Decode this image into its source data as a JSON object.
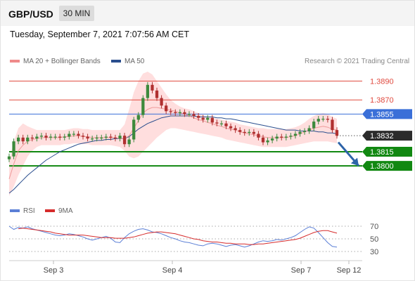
{
  "header": {
    "symbol": "GBP/USD",
    "timeframe": "30 MIN"
  },
  "datetime": "Tuesday, September 7, 2021 7:07:56 AM CET",
  "legend": {
    "bb_label": "MA 20 + Bollinger Bands",
    "ma50_label": "MA 50",
    "credit": "Research © 2021 Trading Central",
    "rsi_label": "RSI",
    "rsi_ma_label": "9MA"
  },
  "colors": {
    "resistance": "#e04a3f",
    "pivot": "#3a6fd8",
    "support": "#118811",
    "current": "#2b2b2b",
    "bands": "#ffd3d3",
    "ma20": "#ef9a9a",
    "ma50": "#2a4e8e",
    "candle_up": "#3c8a3c",
    "candle_down": "#b03030",
    "arrow": "#2d63a8",
    "rsi": "#5b7fd6",
    "rsi_ma": "#d62b2b"
  },
  "chart_data": {
    "type": "line",
    "subtype": "candlestick",
    "price_range": [
      1.3765,
      1.3903
    ],
    "x_ticks": [
      "Sep 3",
      "Sep 4",
      "Sep 7",
      "Sep 12"
    ],
    "levels": [
      {
        "value": 1.389,
        "label": "1.3890",
        "role": "resistance"
      },
      {
        "value": 1.387,
        "label": "1.3870",
        "role": "resistance"
      },
      {
        "value": 1.3855,
        "label": "1.3855",
        "role": "pivot"
      },
      {
        "value": 1.3832,
        "label": "1.3832",
        "role": "current"
      },
      {
        "value": 1.3815,
        "label": "1.3815",
        "role": "support"
      },
      {
        "value": 1.38,
        "label": "1.3800",
        "role": "support"
      }
    ],
    "close_series": [
      1.381,
      1.3826,
      1.383,
      1.3826,
      1.383,
      1.3829,
      1.3831,
      1.3832,
      1.383,
      1.3831,
      1.3831,
      1.383,
      1.3831,
      1.3834,
      1.3834,
      1.3832,
      1.3831,
      1.3829,
      1.3829,
      1.383,
      1.383,
      1.3831,
      1.383,
      1.3829,
      1.3832,
      1.3823,
      1.3828,
      1.3849,
      1.3854,
      1.3872,
      1.3886,
      1.388,
      1.3872,
      1.3864,
      1.3858,
      1.3857,
      1.3856,
      1.3857,
      1.3855,
      1.3855,
      1.3853,
      1.3851,
      1.3849,
      1.3851,
      1.3846,
      1.3845,
      1.3845,
      1.3842,
      1.384,
      1.3838,
      1.3836,
      1.3835,
      1.3836,
      1.3834,
      1.383,
      1.3825,
      1.3827,
      1.3829,
      1.3831,
      1.383,
      1.3831,
      1.3832,
      1.3834,
      1.3836,
      1.3837,
      1.384,
      1.3847,
      1.385,
      1.385,
      1.3849,
      1.3838,
      1.3832
    ],
    "ma20": [
      1.3786,
      1.3802,
      1.3816,
      1.3822,
      1.3826,
      1.3828,
      1.3829,
      1.383,
      1.383,
      1.383,
      1.383,
      1.383,
      1.3831,
      1.3831,
      1.3832,
      1.3832,
      1.3831,
      1.3831,
      1.383,
      1.383,
      1.383,
      1.383,
      1.383,
      1.383,
      1.3829,
      1.3829,
      1.3832,
      1.384,
      1.3848,
      1.3856,
      1.386,
      1.3862,
      1.3862,
      1.3861,
      1.386,
      1.3859,
      1.3858,
      1.3856,
      1.3855,
      1.3853,
      1.3851,
      1.3849,
      1.3848,
      1.3846,
      1.3845,
      1.3843,
      1.3842,
      1.384,
      1.3839,
      1.3838,
      1.3836,
      1.3835,
      1.3834,
      1.3833,
      1.3832,
      1.3831,
      1.383,
      1.383,
      1.383,
      1.383,
      1.383,
      1.3831,
      1.3832,
      1.3834,
      1.3836,
      1.3838,
      1.384,
      1.3841,
      1.3842,
      1.3841,
      1.3839,
      1.3838
    ],
    "bb_upper": [
      1.3805,
      1.3826,
      1.384,
      1.3845,
      1.3842,
      1.384,
      1.3838,
      1.3838,
      1.3838,
      1.3838,
      1.3838,
      1.3838,
      1.3838,
      1.3839,
      1.384,
      1.384,
      1.3839,
      1.3839,
      1.3838,
      1.3838,
      1.3838,
      1.3838,
      1.3838,
      1.3838,
      1.3838,
      1.3844,
      1.386,
      1.3878,
      1.389,
      1.3898,
      1.39,
      1.3897,
      1.389,
      1.3883,
      1.3876,
      1.387,
      1.3866,
      1.3863,
      1.3861,
      1.386,
      1.3858,
      1.3856,
      1.3854,
      1.3852,
      1.3851,
      1.385,
      1.3849,
      1.3848,
      1.3847,
      1.3846,
      1.3844,
      1.3843,
      1.3842,
      1.3841,
      1.384,
      1.384,
      1.3839,
      1.3839,
      1.3839,
      1.3839,
      1.3839,
      1.384,
      1.3841,
      1.3843,
      1.3846,
      1.385,
      1.3853,
      1.3855,
      1.3856,
      1.3855,
      1.3852,
      1.385
    ],
    "bb_lower": [
      1.3768,
      1.3778,
      1.379,
      1.38,
      1.381,
      1.3816,
      1.382,
      1.3822,
      1.3822,
      1.3822,
      1.3822,
      1.3822,
      1.3823,
      1.3823,
      1.3824,
      1.3824,
      1.3823,
      1.3823,
      1.3822,
      1.3822,
      1.3822,
      1.3822,
      1.3822,
      1.3821,
      1.382,
      1.3816,
      1.381,
      1.3808,
      1.381,
      1.3815,
      1.382,
      1.3825,
      1.383,
      1.3834,
      1.3838,
      1.384,
      1.384,
      1.3839,
      1.3838,
      1.3837,
      1.3836,
      1.3835,
      1.3834,
      1.3833,
      1.3832,
      1.3831,
      1.383,
      1.3828,
      1.3827,
      1.3826,
      1.3825,
      1.3824,
      1.3823,
      1.3822,
      1.3821,
      1.382,
      1.382,
      1.382,
      1.382,
      1.382,
      1.382,
      1.3821,
      1.3822,
      1.3823,
      1.3824,
      1.3825,
      1.3826,
      1.3826,
      1.3826,
      1.3826,
      1.3825,
      1.3824
    ],
    "ma50": [
      1.3771,
      1.3775,
      1.378,
      1.3785,
      1.379,
      1.3794,
      1.3798,
      1.3802,
      1.3806,
      1.3809,
      1.3812,
      1.3815,
      1.3817,
      1.3819,
      1.3821,
      1.3823,
      1.3824,
      1.3825,
      1.3826,
      1.3827,
      1.3827,
      1.3828,
      1.3828,
      1.3829,
      1.3829,
      1.3829,
      1.3831,
      1.3835,
      1.3839,
      1.3842,
      1.3845,
      1.3847,
      1.3849,
      1.3851,
      1.3852,
      1.3853,
      1.3853,
      1.3853,
      1.3853,
      1.3853,
      1.3853,
      1.3852,
      1.3852,
      1.3852,
      1.3852,
      1.3851,
      1.3851,
      1.385,
      1.385,
      1.3849,
      1.3848,
      1.3847,
      1.3846,
      1.3845,
      1.3844,
      1.3843,
      1.3842,
      1.3841,
      1.384,
      1.3839,
      1.3838,
      1.3838,
      1.3838,
      1.3837,
      1.3837,
      1.3837,
      1.3837,
      1.3836,
      1.3836,
      1.3835,
      1.3835,
      1.3834
    ],
    "forecast_arrow": {
      "from": 1.3825,
      "to": 1.38
    },
    "rsi": {
      "levels": [
        70,
        50,
        30
      ],
      "level_labels": [
        "70",
        "50",
        "30"
      ],
      "range": [
        20,
        80
      ],
      "values": [
        70,
        65,
        68,
        67,
        69,
        66,
        64,
        62,
        60,
        58,
        56,
        55,
        56,
        58,
        57,
        55,
        53,
        50,
        48,
        50,
        52,
        54,
        51,
        45,
        44,
        52,
        58,
        62,
        65,
        66,
        64,
        61,
        60,
        58,
        55,
        52,
        50,
        47,
        45,
        44,
        42,
        40,
        39,
        42,
        43,
        42,
        40,
        38,
        40,
        41,
        39,
        37,
        39,
        42,
        45,
        47,
        46,
        47,
        49,
        48,
        50,
        52,
        55,
        60,
        65,
        69,
        67,
        60,
        52,
        44,
        38,
        37
      ],
      "ma": [
        66,
        67,
        66,
        65,
        64,
        63,
        62,
        61,
        59,
        58,
        57,
        56,
        56,
        56,
        56,
        55,
        54,
        53,
        52,
        52,
        52,
        51,
        51,
        51,
        52,
        53,
        55,
        57,
        59,
        60,
        61,
        61,
        60,
        59,
        58,
        56,
        54,
        52,
        50,
        49,
        47,
        46,
        45,
        45,
        44,
        43,
        43,
        42,
        42,
        42,
        41,
        41,
        42,
        42,
        43,
        44,
        45,
        46,
        47,
        48,
        49,
        51,
        54,
        57,
        60,
        62,
        63,
        63,
        61,
        59
      ]
    }
  }
}
